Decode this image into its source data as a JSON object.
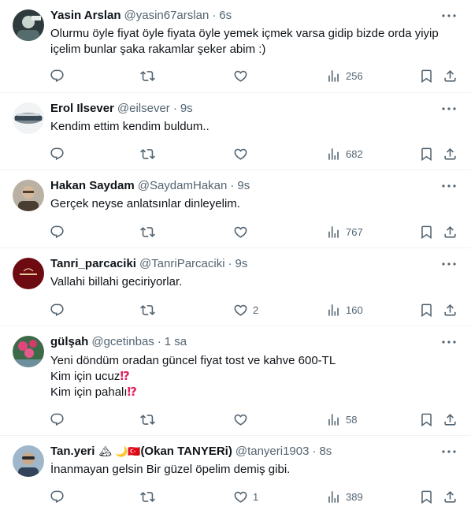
{
  "tweets": [
    {
      "name": "Yasin Arslan",
      "handle": "@yasin67arslan",
      "time": "6s",
      "lines": [
        "Olurmu öyle fiyat öyle fiyata öyle yemek içmek varsa gidip bizde orda yiyip",
        "içelim bunlar şaka rakamlar şeker abim :)"
      ],
      "replies": "",
      "retweets": "",
      "likes": "",
      "views": "256",
      "avatar": {
        "bg": "#2e3a3c",
        "fg": "#c9d6cf"
      }
    },
    {
      "name": "Erol Ilsever",
      "handle": "@eilsever",
      "time": "9s",
      "lines": [
        "Kendim ettim kendim buldum.."
      ],
      "replies": "",
      "retweets": "",
      "likes": "",
      "views": "682",
      "avatar": {
        "bg": "#f1f3f4",
        "fg": "#3a4b57"
      }
    },
    {
      "name": "Hakan Saydam",
      "handle": "@SaydamHakan",
      "time": "9s",
      "lines": [
        "Gerçek neyse anlatsınlar dinleyelim."
      ],
      "replies": "",
      "retweets": "",
      "likes": "",
      "views": "767",
      "avatar": {
        "bg": "#b9b1a3",
        "fg": "#4a3e33"
      }
    },
    {
      "name": "Tanri_parcaciki",
      "handle": "@TanriParcaciki",
      "time": "9s",
      "lines": [
        "Vallahi billahi geciriyorlar."
      ],
      "replies": "",
      "retweets": "",
      "likes": "2",
      "views": "160",
      "avatar": {
        "bg": "#6e0b12",
        "fg": "#e9c9a0"
      }
    },
    {
      "name": "gülşah",
      "handle": "@gcetinbas",
      "time": "1 sa",
      "lines": [
        "Yeni döndüm oradan güncel fiyat tost ve kahve 600-TL",
        "Kim için ucuz",
        "Kim için pahalı"
      ],
      "bangs": [
        "",
        "⁉",
        "⁉"
      ],
      "replies": "",
      "retweets": "",
      "likes": "",
      "views": "58",
      "avatar": {
        "bg": "#3d6b4a",
        "fg": "#e0457b"
      }
    },
    {
      "name": "Tan.yeri",
      "name_emoji": "🏔 🌙🇹🇷",
      "name_suffix": "(Okan TANYERi)",
      "handle": "@tanyeri1903",
      "time": "8s",
      "lines": [
        "İnanmayan gelsin Bir güzel öpelim demiş gibi."
      ],
      "replies": "",
      "retweets": "",
      "likes": "1",
      "views": "389",
      "avatar": {
        "bg": "#9fb7c9",
        "fg": "#2a2a2a"
      }
    }
  ]
}
